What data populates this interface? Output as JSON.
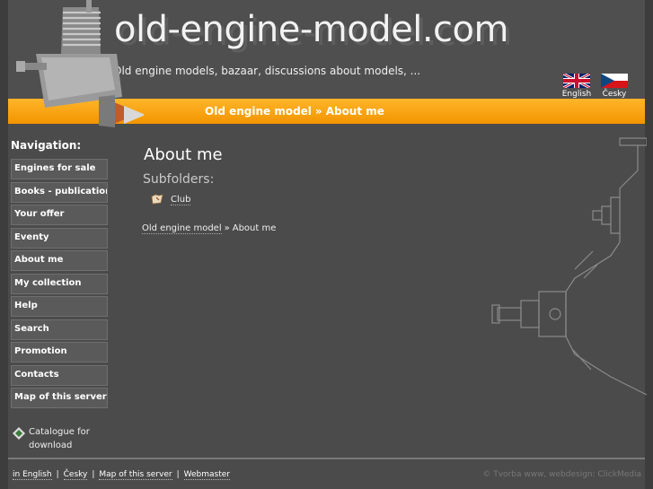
{
  "header": {
    "title": "old-engine-model.com",
    "tagline": "Old engine models, bazaar, discussions about models, ..."
  },
  "languages": [
    {
      "label": "English",
      "icon": "uk-flag-icon"
    },
    {
      "label": "Česky",
      "icon": "cz-flag-icon"
    }
  ],
  "breadcrumb_bar": {
    "home": "Old engine model",
    "separator": "»",
    "current": "About me"
  },
  "nav": {
    "title": "Navigation:",
    "items": [
      {
        "label": "Engines for sale"
      },
      {
        "label": "Books - publication"
      },
      {
        "label": "Your offer"
      },
      {
        "label": "Eventy"
      },
      {
        "label": "About me"
      },
      {
        "label": "My collection"
      },
      {
        "label": "Help"
      },
      {
        "label": "Search"
      },
      {
        "label": "Promotion"
      },
      {
        "label": "Contacts"
      },
      {
        "label": "Map of this server"
      }
    ]
  },
  "catalogue": {
    "label": "Catalogue for download",
    "icon": "download-icon"
  },
  "main": {
    "title": "About me",
    "subfolders_label": "Subfolders:",
    "folders": [
      {
        "label": "Club",
        "icon": "folder-icon"
      }
    ],
    "path": {
      "home": "Old engine model",
      "separator": "»",
      "current": "About me"
    }
  },
  "footer": {
    "links": [
      "in English",
      "Česky",
      "Map of this server",
      "Webmaster"
    ],
    "separator": "|",
    "credit": "© Tvorba www, webdesign: ClickMedia"
  },
  "colors": {
    "accent": "#f7a11a",
    "background": "#4b4b4b",
    "outer": "#3d3d3d"
  }
}
